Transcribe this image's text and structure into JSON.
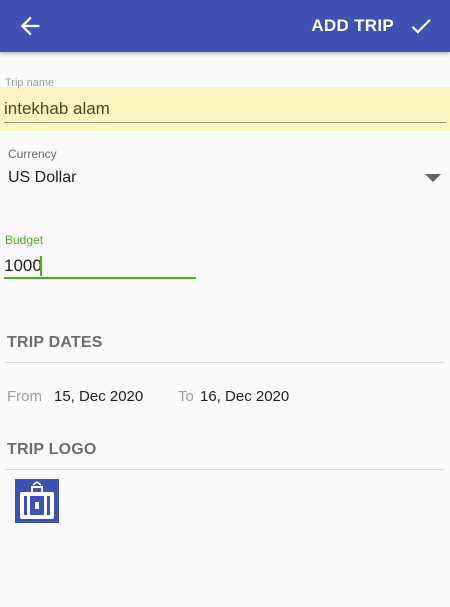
{
  "header": {
    "back_icon": "arrow-left-icon",
    "action_label": "ADD TRIP",
    "action_icon": "check-icon",
    "color": "#3f51b5"
  },
  "form": {
    "trip_name": {
      "label": "Trip name",
      "value": "intekhab alam",
      "highlight_color": "#fdf5c1"
    },
    "currency": {
      "label": "Currency",
      "value": "US Dollar",
      "icon": "dropdown-caret-icon"
    },
    "budget": {
      "label": "Budget",
      "value": "1000",
      "accent_color": "#4caf20"
    }
  },
  "trip_dates": {
    "heading": "TRIP DATES",
    "from_label": "From",
    "from_value": "15, Dec 2020",
    "to_label": "To",
    "to_value": "16, Dec 2020"
  },
  "trip_logo": {
    "heading": "TRIP LOGO",
    "icon": "suitcase-icon",
    "icon_color": "#3f51b5"
  }
}
